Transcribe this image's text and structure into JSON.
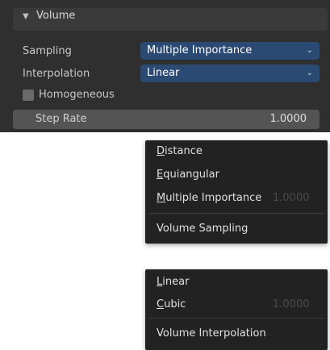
{
  "panel": {
    "title": "Volume",
    "collapse_glyph": "▼",
    "rows": {
      "sampling_label": "Sampling",
      "sampling_value": "Multiple Importance",
      "interpolation_label": "Interpolation",
      "interpolation_value": "Linear",
      "homogeneous_label": "Homogeneous",
      "step_rate_label": "Step Rate",
      "step_rate_value": "1.0000"
    },
    "chevron_glyph": "⌄",
    "colors": {
      "panel_bg": "#2f2f2f",
      "dropdown_blue": "#2b4a73",
      "field_gray": "#545454",
      "menu_bg": "#222222"
    }
  },
  "sampling_menu": {
    "items": [
      "Distance",
      "Equiangular",
      "Multiple Importance"
    ],
    "mnemonic_first": [
      "D",
      "E",
      "M"
    ],
    "items_rest": [
      "istance",
      "quiangular",
      "ultiple Importance"
    ],
    "footer": "Volume Sampling",
    "ghost_value": "1.0000"
  },
  "interp_menu": {
    "items": [
      "Linear",
      "Cubic"
    ],
    "mnemonic_first": [
      "L",
      "C"
    ],
    "items_rest": [
      "inear",
      "ubic"
    ],
    "footer": "Volume Interpolation",
    "ghost_value": "1.0000"
  }
}
